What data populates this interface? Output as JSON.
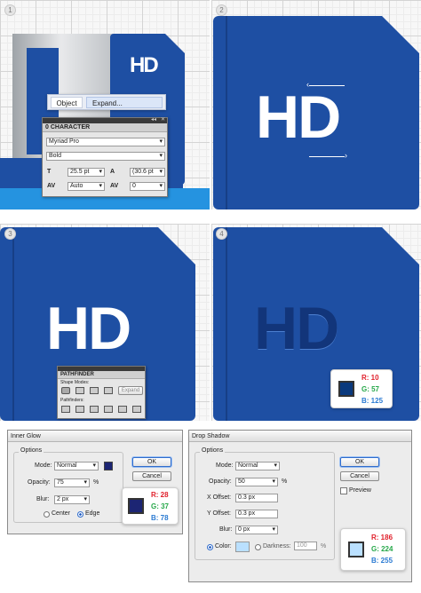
{
  "steps": [
    "1",
    "2",
    "3",
    "4"
  ],
  "logo_text": "HD",
  "context_menu": {
    "object": "Object",
    "expand": "Expand..."
  },
  "character": {
    "title": "0 CHARACTER",
    "font": "Myriad Pro",
    "style": "Bold",
    "size": "25.5 pt",
    "leading": "(30.6 pt",
    "kerning": "Auto",
    "tracking": "0"
  },
  "pathfinder": {
    "title": "PATHFINDER",
    "shape_modes": "Shape Modes:",
    "pathfinders": "Pathfinders:",
    "expand": "Expand"
  },
  "rgb_step4": {
    "r": "R: 10",
    "g": "G: 57",
    "b": "B: 125",
    "color": "#0a397d"
  },
  "inner_glow": {
    "title": "Inner Glow",
    "options": "Options",
    "mode_label": "Mode:",
    "mode": "Normal",
    "opacity_label": "Opacity:",
    "opacity": "75",
    "pct": "%",
    "blur_label": "Blur:",
    "blur": "2 px",
    "center": "Center",
    "edge": "Edge",
    "ok": "OK",
    "cancel": "Cancel",
    "color": "#1c2573",
    "r": "R: 28",
    "g": "G: 37",
    "b": "B: 78"
  },
  "drop_shadow": {
    "title": "Drop Shadow",
    "options": "Options",
    "mode_label": "Mode:",
    "mode": "Normal",
    "opacity_label": "Opacity:",
    "opacity": "50",
    "pct": "%",
    "xoff_label": "X Offset:",
    "xoff": "0.3 px",
    "yoff_label": "Y Offset:",
    "yoff": "0.3 px",
    "blur_label": "Blur:",
    "blur": "0 px",
    "color_label": "Color:",
    "darkness_label": "Darkness:",
    "darkness": "100",
    "ok": "OK",
    "cancel": "Cancel",
    "preview": "Preview",
    "color": "#bae0ff",
    "r": "R: 186",
    "g": "G: 224",
    "b": "B: 255"
  },
  "colors": {
    "blue": "#1e4fa3",
    "blue_dark": "#173f86",
    "gray_shape": "#bfc3c8"
  }
}
